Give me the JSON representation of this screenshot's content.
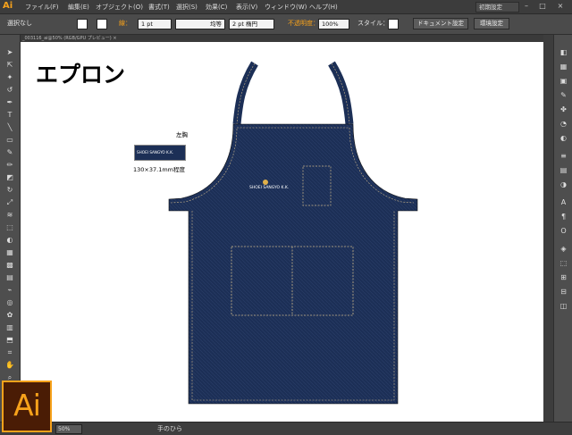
{
  "app": {
    "logo": "Ai",
    "big_logo": "Ai"
  },
  "menu": [
    "ファイル(F)",
    "編集(E)",
    "オブジェクト(O)",
    "書式(T)",
    "選択(S)",
    "効果(C)",
    "表示(V)",
    "ウィンドウ(W)",
    "ヘルプ(H)"
  ],
  "workspace": "初期設定",
  "window_controls": [
    "–",
    "□",
    "×"
  ],
  "control": {
    "selection": "選択なし",
    "stroke_label": "線：",
    "stroke_weight": "1 pt",
    "stroke_profile": "均等",
    "brush": "2 pt 楕円",
    "opacity_label": "不透明度：",
    "opacity_value": "100%",
    "style_label": "スタイル：",
    "doc_setup_button": "ドキュメント設定",
    "prefs_button": "環境設定"
  },
  "doc_tab": "_003116_ai@50% (RGB/GPU プレビュー) ×",
  "canvas": {
    "title": "エプロン",
    "chest_label": "左胸",
    "logo_text": "SHOEI SANGYO K.K.",
    "logo_size": "130×37.1mm程度"
  },
  "status": {
    "zoom": "50%",
    "tool": "手のひら"
  },
  "colors": {
    "apron": "#1c2f56",
    "stitch": "#c9b48a",
    "accent": "#f7a21b"
  }
}
